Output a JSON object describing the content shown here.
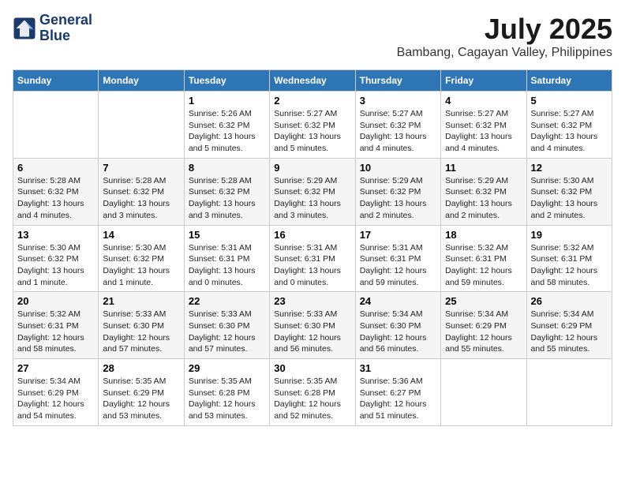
{
  "header": {
    "logo_line1": "General",
    "logo_line2": "Blue",
    "month_title": "July 2025",
    "location": "Bambang, Cagayan Valley, Philippines"
  },
  "weekdays": [
    "Sunday",
    "Monday",
    "Tuesday",
    "Wednesday",
    "Thursday",
    "Friday",
    "Saturday"
  ],
  "weeks": [
    [
      {
        "day": "",
        "info": ""
      },
      {
        "day": "",
        "info": ""
      },
      {
        "day": "1",
        "info": "Sunrise: 5:26 AM\nSunset: 6:32 PM\nDaylight: 13 hours and 5 minutes."
      },
      {
        "day": "2",
        "info": "Sunrise: 5:27 AM\nSunset: 6:32 PM\nDaylight: 13 hours and 5 minutes."
      },
      {
        "day": "3",
        "info": "Sunrise: 5:27 AM\nSunset: 6:32 PM\nDaylight: 13 hours and 4 minutes."
      },
      {
        "day": "4",
        "info": "Sunrise: 5:27 AM\nSunset: 6:32 PM\nDaylight: 13 hours and 4 minutes."
      },
      {
        "day": "5",
        "info": "Sunrise: 5:27 AM\nSunset: 6:32 PM\nDaylight: 13 hours and 4 minutes."
      }
    ],
    [
      {
        "day": "6",
        "info": "Sunrise: 5:28 AM\nSunset: 6:32 PM\nDaylight: 13 hours and 4 minutes."
      },
      {
        "day": "7",
        "info": "Sunrise: 5:28 AM\nSunset: 6:32 PM\nDaylight: 13 hours and 3 minutes."
      },
      {
        "day": "8",
        "info": "Sunrise: 5:28 AM\nSunset: 6:32 PM\nDaylight: 13 hours and 3 minutes."
      },
      {
        "day": "9",
        "info": "Sunrise: 5:29 AM\nSunset: 6:32 PM\nDaylight: 13 hours and 3 minutes."
      },
      {
        "day": "10",
        "info": "Sunrise: 5:29 AM\nSunset: 6:32 PM\nDaylight: 13 hours and 2 minutes."
      },
      {
        "day": "11",
        "info": "Sunrise: 5:29 AM\nSunset: 6:32 PM\nDaylight: 13 hours and 2 minutes."
      },
      {
        "day": "12",
        "info": "Sunrise: 5:30 AM\nSunset: 6:32 PM\nDaylight: 13 hours and 2 minutes."
      }
    ],
    [
      {
        "day": "13",
        "info": "Sunrise: 5:30 AM\nSunset: 6:32 PM\nDaylight: 13 hours and 1 minute."
      },
      {
        "day": "14",
        "info": "Sunrise: 5:30 AM\nSunset: 6:32 PM\nDaylight: 13 hours and 1 minute."
      },
      {
        "day": "15",
        "info": "Sunrise: 5:31 AM\nSunset: 6:31 PM\nDaylight: 13 hours and 0 minutes."
      },
      {
        "day": "16",
        "info": "Sunrise: 5:31 AM\nSunset: 6:31 PM\nDaylight: 13 hours and 0 minutes."
      },
      {
        "day": "17",
        "info": "Sunrise: 5:31 AM\nSunset: 6:31 PM\nDaylight: 12 hours and 59 minutes."
      },
      {
        "day": "18",
        "info": "Sunrise: 5:32 AM\nSunset: 6:31 PM\nDaylight: 12 hours and 59 minutes."
      },
      {
        "day": "19",
        "info": "Sunrise: 5:32 AM\nSunset: 6:31 PM\nDaylight: 12 hours and 58 minutes."
      }
    ],
    [
      {
        "day": "20",
        "info": "Sunrise: 5:32 AM\nSunset: 6:31 PM\nDaylight: 12 hours and 58 minutes."
      },
      {
        "day": "21",
        "info": "Sunrise: 5:33 AM\nSunset: 6:30 PM\nDaylight: 12 hours and 57 minutes."
      },
      {
        "day": "22",
        "info": "Sunrise: 5:33 AM\nSunset: 6:30 PM\nDaylight: 12 hours and 57 minutes."
      },
      {
        "day": "23",
        "info": "Sunrise: 5:33 AM\nSunset: 6:30 PM\nDaylight: 12 hours and 56 minutes."
      },
      {
        "day": "24",
        "info": "Sunrise: 5:34 AM\nSunset: 6:30 PM\nDaylight: 12 hours and 56 minutes."
      },
      {
        "day": "25",
        "info": "Sunrise: 5:34 AM\nSunset: 6:29 PM\nDaylight: 12 hours and 55 minutes."
      },
      {
        "day": "26",
        "info": "Sunrise: 5:34 AM\nSunset: 6:29 PM\nDaylight: 12 hours and 55 minutes."
      }
    ],
    [
      {
        "day": "27",
        "info": "Sunrise: 5:34 AM\nSunset: 6:29 PM\nDaylight: 12 hours and 54 minutes."
      },
      {
        "day": "28",
        "info": "Sunrise: 5:35 AM\nSunset: 6:29 PM\nDaylight: 12 hours and 53 minutes."
      },
      {
        "day": "29",
        "info": "Sunrise: 5:35 AM\nSunset: 6:28 PM\nDaylight: 12 hours and 53 minutes."
      },
      {
        "day": "30",
        "info": "Sunrise: 5:35 AM\nSunset: 6:28 PM\nDaylight: 12 hours and 52 minutes."
      },
      {
        "day": "31",
        "info": "Sunrise: 5:36 AM\nSunset: 6:27 PM\nDaylight: 12 hours and 51 minutes."
      },
      {
        "day": "",
        "info": ""
      },
      {
        "day": "",
        "info": ""
      }
    ]
  ]
}
